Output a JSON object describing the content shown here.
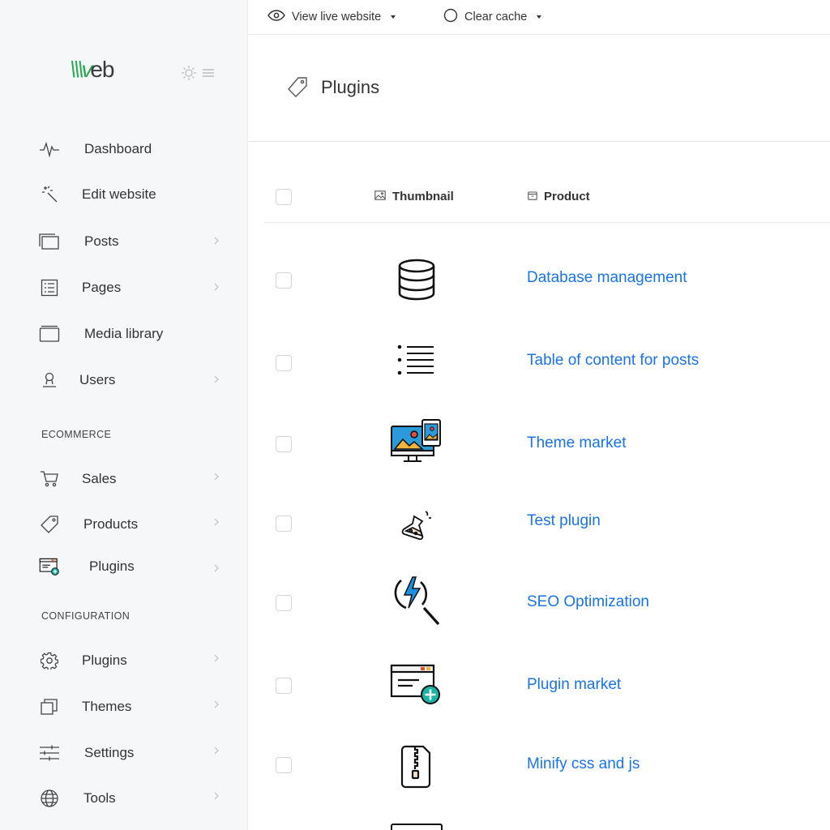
{
  "topbar": {
    "view_live": "View live website",
    "clear_cache": "Clear cache"
  },
  "sidebar": {
    "logo_accent": "\\\\\\v",
    "logo_rest": "eb",
    "main_items": [
      {
        "label": "Dashboard",
        "icon": "activity-icon"
      },
      {
        "label": "Edit website",
        "icon": "magic-wand-icon"
      },
      {
        "label": "Posts",
        "icon": "copy-icon"
      },
      {
        "label": "Pages",
        "icon": "list-icon"
      },
      {
        "label": "Media library",
        "icon": "folder-icon"
      },
      {
        "label": "Users",
        "icon": "user-icon"
      }
    ],
    "ecommerce_label": "ECOMMERCE",
    "ecommerce_items": [
      {
        "label": "Sales",
        "icon": "cart-icon"
      },
      {
        "label": "Products",
        "icon": "tag-icon"
      },
      {
        "label": "Plugins",
        "icon": "plugin-window-icon"
      }
    ],
    "configuration_label": "CONFIGURATION",
    "configuration_items": [
      {
        "label": "Plugins",
        "icon": "gear-icon"
      },
      {
        "label": "Themes",
        "icon": "layers-icon"
      },
      {
        "label": "Settings",
        "icon": "sliders-icon"
      },
      {
        "label": "Tools",
        "icon": "globe-icon"
      }
    ]
  },
  "page": {
    "title": "Plugins"
  },
  "table": {
    "columns": {
      "thumbnail": "Thumbnail",
      "product": "Product"
    },
    "rows": [
      {
        "name": "Database management",
        "icon": "database-icon"
      },
      {
        "name": "Table of content for posts",
        "icon": "list-icon"
      },
      {
        "name": "Theme market",
        "icon": "monitor-images-icon"
      },
      {
        "name": "Test plugin",
        "icon": "flask-icon"
      },
      {
        "name": "SEO Optimization",
        "icon": "search-lightning-icon"
      },
      {
        "name": "Plugin market",
        "icon": "window-plus-icon"
      },
      {
        "name": "Minify css and js",
        "icon": "zip-file-icon"
      }
    ]
  },
  "colors": {
    "link": "#1a73e8",
    "logo_accent": "#2aa855",
    "plugin_icon_teal": "#1bb3a6",
    "sidebar_bg": "#f6f7f8"
  }
}
